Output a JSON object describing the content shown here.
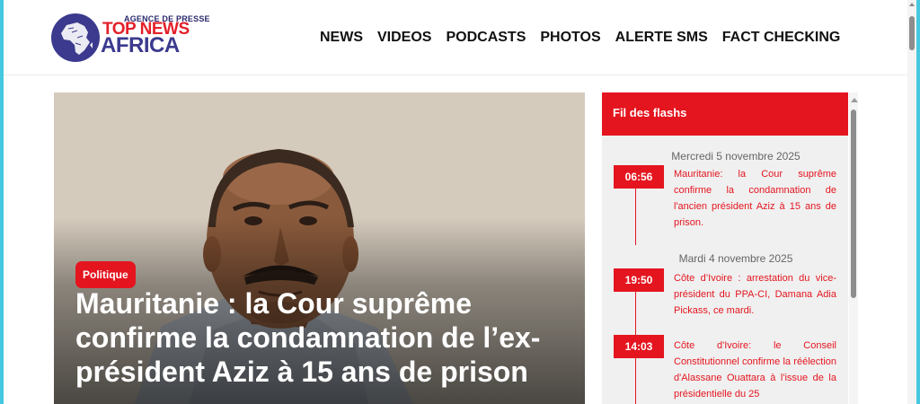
{
  "logo": {
    "tagline": "AGENCE DE PRESSE",
    "line1": "TOP NEWS",
    "line2": "AFRICA"
  },
  "nav": [
    "NEWS",
    "VIDEOS",
    "PODCASTS",
    "PHOTOS",
    "ALERTE SMS",
    "FACT CHECKING"
  ],
  "hero": {
    "category": "Politique",
    "title": "Mauritanie : la Cour suprême confirme la condamnation de l’ex-président Aziz à 15 ans de prison"
  },
  "flash": {
    "heading": "Fil des flashs",
    "days": [
      {
        "date": "Mercredi 5 novembre 2025",
        "items": [
          {
            "time": "06:56",
            "text": "Mauritanie: la Cour suprême confirme la condamnation de l'ancien président Aziz à 15 ans de prison."
          }
        ]
      },
      {
        "date": "Mardi 4 novembre 2025",
        "items": [
          {
            "time": "19:50",
            "text": "Côte d’Ivoire : arrestation du vice-président du PPA-CI, Damana Adia Pickass, ce mardi."
          },
          {
            "time": "14:03",
            "text": "Côte d'Ivoire: le Conseil Constitutionnel confirme la réélection d'Alassane Ouattara à l'issue de la présidentielle du 25"
          }
        ]
      }
    ]
  },
  "colors": {
    "accent": "#e4151f",
    "brand_blue": "#3b3a8e",
    "frame": "#46c8e0"
  }
}
